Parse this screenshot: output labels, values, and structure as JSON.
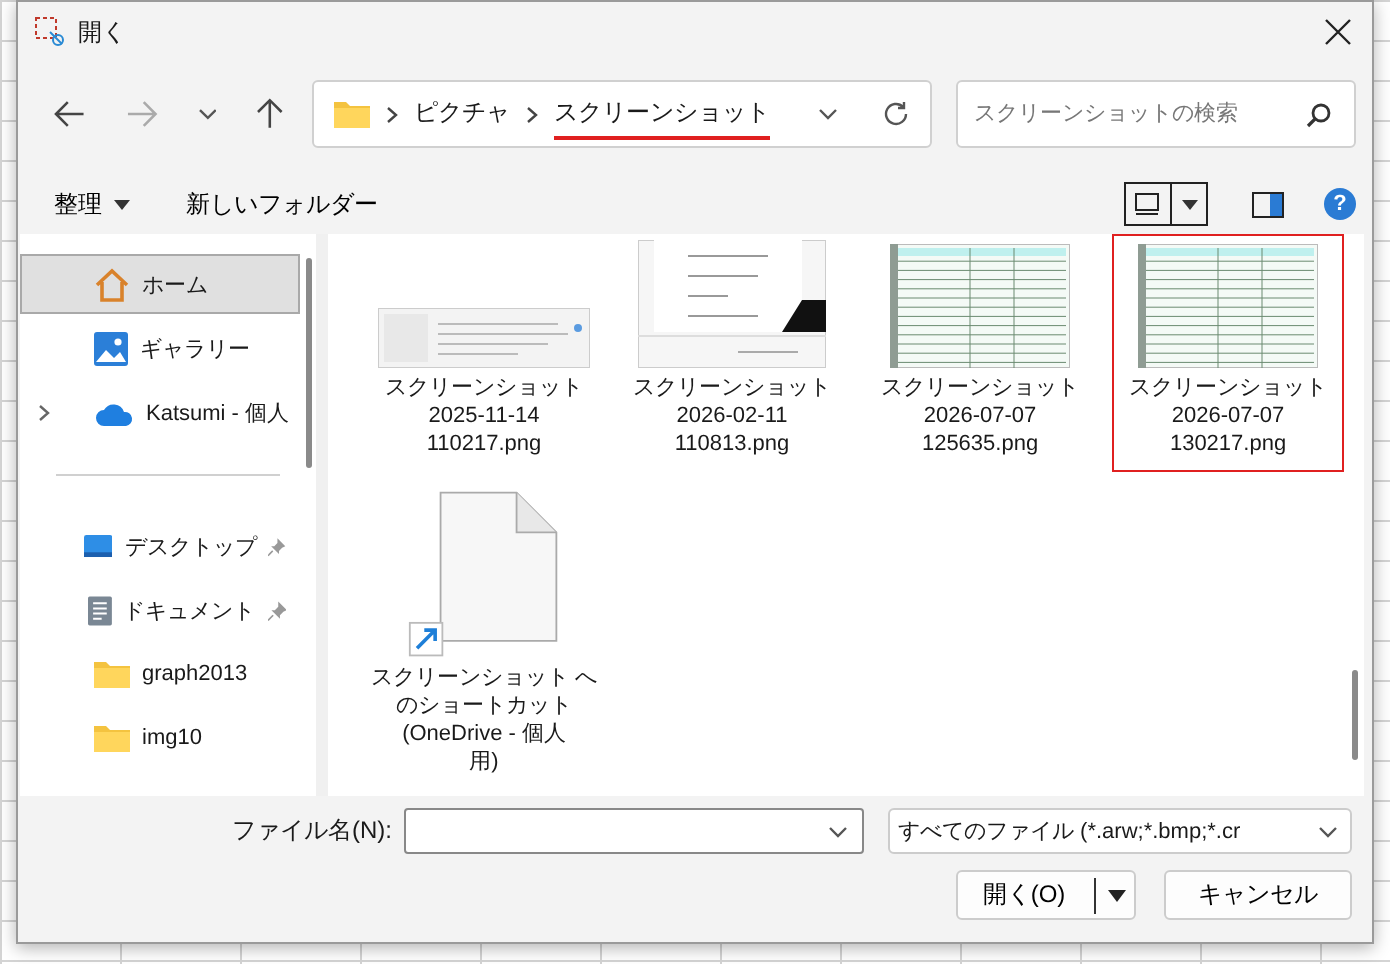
{
  "window": {
    "title": "開く"
  },
  "address": {
    "segments": [
      {
        "label": "ピクチャ",
        "underlined": false
      },
      {
        "label": "スクリーンショット",
        "underlined": true
      }
    ]
  },
  "search": {
    "placeholder": "スクリーンショットの検索"
  },
  "toolbar": {
    "organize": "整理",
    "new_folder": "新しいフォルダー",
    "help": "?"
  },
  "sidebar": {
    "items": [
      {
        "kind": "home",
        "label": "ホーム",
        "selected": true,
        "pinned": false,
        "expandable": false
      },
      {
        "kind": "gallery",
        "label": "ギャラリー",
        "selected": false,
        "pinned": false,
        "expandable": false
      },
      {
        "kind": "cloud",
        "label": "Katsumi - 個人",
        "selected": false,
        "pinned": false,
        "expandable": true
      },
      {
        "kind": "divider"
      },
      {
        "kind": "desktop",
        "label": "デスクトップ",
        "selected": false,
        "pinned": true,
        "expandable": false
      },
      {
        "kind": "document",
        "label": "ドキュメント",
        "selected": false,
        "pinned": true,
        "expandable": false
      },
      {
        "kind": "folder",
        "label": "graph2013",
        "selected": false,
        "pinned": false,
        "expandable": false
      },
      {
        "kind": "folder",
        "label": "img10",
        "selected": false,
        "pinned": false,
        "expandable": false
      }
    ]
  },
  "files": [
    {
      "kind": "window",
      "name_lines": [
        "スクリーンショット",
        "2025-11-14",
        "110217.png"
      ],
      "selected": false
    },
    {
      "kind": "menu",
      "name_lines": [
        "スクリーンショット",
        "2026-02-11",
        "110813.png"
      ],
      "selected": false
    },
    {
      "kind": "sheet",
      "name_lines": [
        "スクリーンショット",
        "2026-07-07",
        "125635.png"
      ],
      "selected": false
    },
    {
      "kind": "sheet",
      "name_lines": [
        "スクリーンショット",
        "2026-07-07",
        "130217.png"
      ],
      "selected": true
    },
    {
      "kind": "shortcut",
      "name_lines": [
        "スクリーンショット へ",
        "のショートカット",
        "(OneDrive - 個人",
        "用)"
      ],
      "selected": false
    }
  ],
  "footer": {
    "filename_label": "ファイル名(N):",
    "filter": "すべてのファイル (*.arw;*.bmp;*.cr",
    "open": "開く(O)",
    "cancel": "キャンセル"
  }
}
